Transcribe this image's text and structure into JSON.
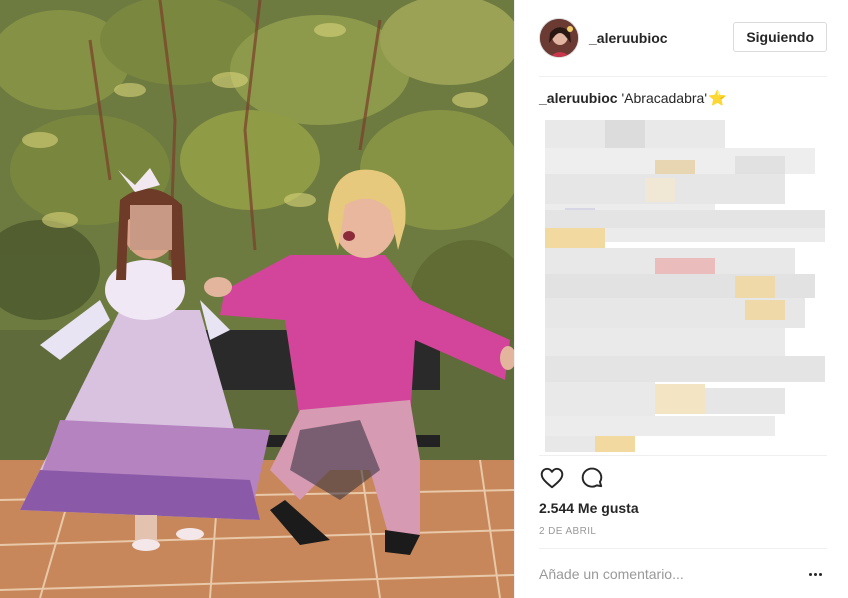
{
  "post": {
    "username": "_aleruubioc",
    "follow_label": "Siguiendo",
    "caption_user": "_aleruubioc",
    "caption_text": "'Abracadabra'",
    "caption_emoji": "⭐",
    "likes": "2.544 Me gusta",
    "date": "2 DE ABRIL",
    "comment_placeholder": "Añade un comentario..."
  },
  "icons": {
    "like": "heart-icon",
    "comment": "comment-bubble-icon",
    "more": "more-options-icon"
  },
  "colors": {
    "text": "#262626",
    "muted": "#999999",
    "border": "#dbdbdb"
  }
}
